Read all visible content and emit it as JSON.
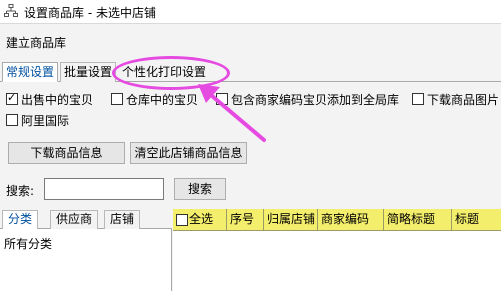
{
  "window": {
    "title": "设置商品库 - 未选中店铺",
    "icon": "hierarchy-icon"
  },
  "section": {
    "title": "建立商品库"
  },
  "tabs": [
    {
      "label": "常规设置",
      "active": true
    },
    {
      "label": "批量设置",
      "active": false
    },
    {
      "label": "个性化打印设置",
      "active": false
    }
  ],
  "options": [
    {
      "label": "出售中的宝贝",
      "checked": true
    },
    {
      "label": "仓库中的宝贝",
      "checked": false
    },
    {
      "label": "包含商家编码宝贝添加到全局库",
      "checked": false
    },
    {
      "label": "下载商品图片",
      "checked": false
    },
    {
      "label": "阿里国际",
      "checked": false
    }
  ],
  "buttons": {
    "download": "下载商品信息",
    "clear": "清空此店铺商品信息",
    "search": "搜索"
  },
  "search": {
    "label": "搜索:",
    "value": ""
  },
  "left_panel": {
    "tabs": [
      "分类",
      "供应商",
      "店铺"
    ],
    "active_tab": "分类",
    "items": [
      "所有分类"
    ]
  },
  "grid": {
    "select_all_label": "全选",
    "columns": [
      "序号",
      "归属店铺",
      "商家编码",
      "简略标题",
      "标题"
    ]
  },
  "colors": {
    "highlight": "#e54be0",
    "grid_header": "#f4ee6d",
    "active_tab_text": "#0050a0"
  }
}
